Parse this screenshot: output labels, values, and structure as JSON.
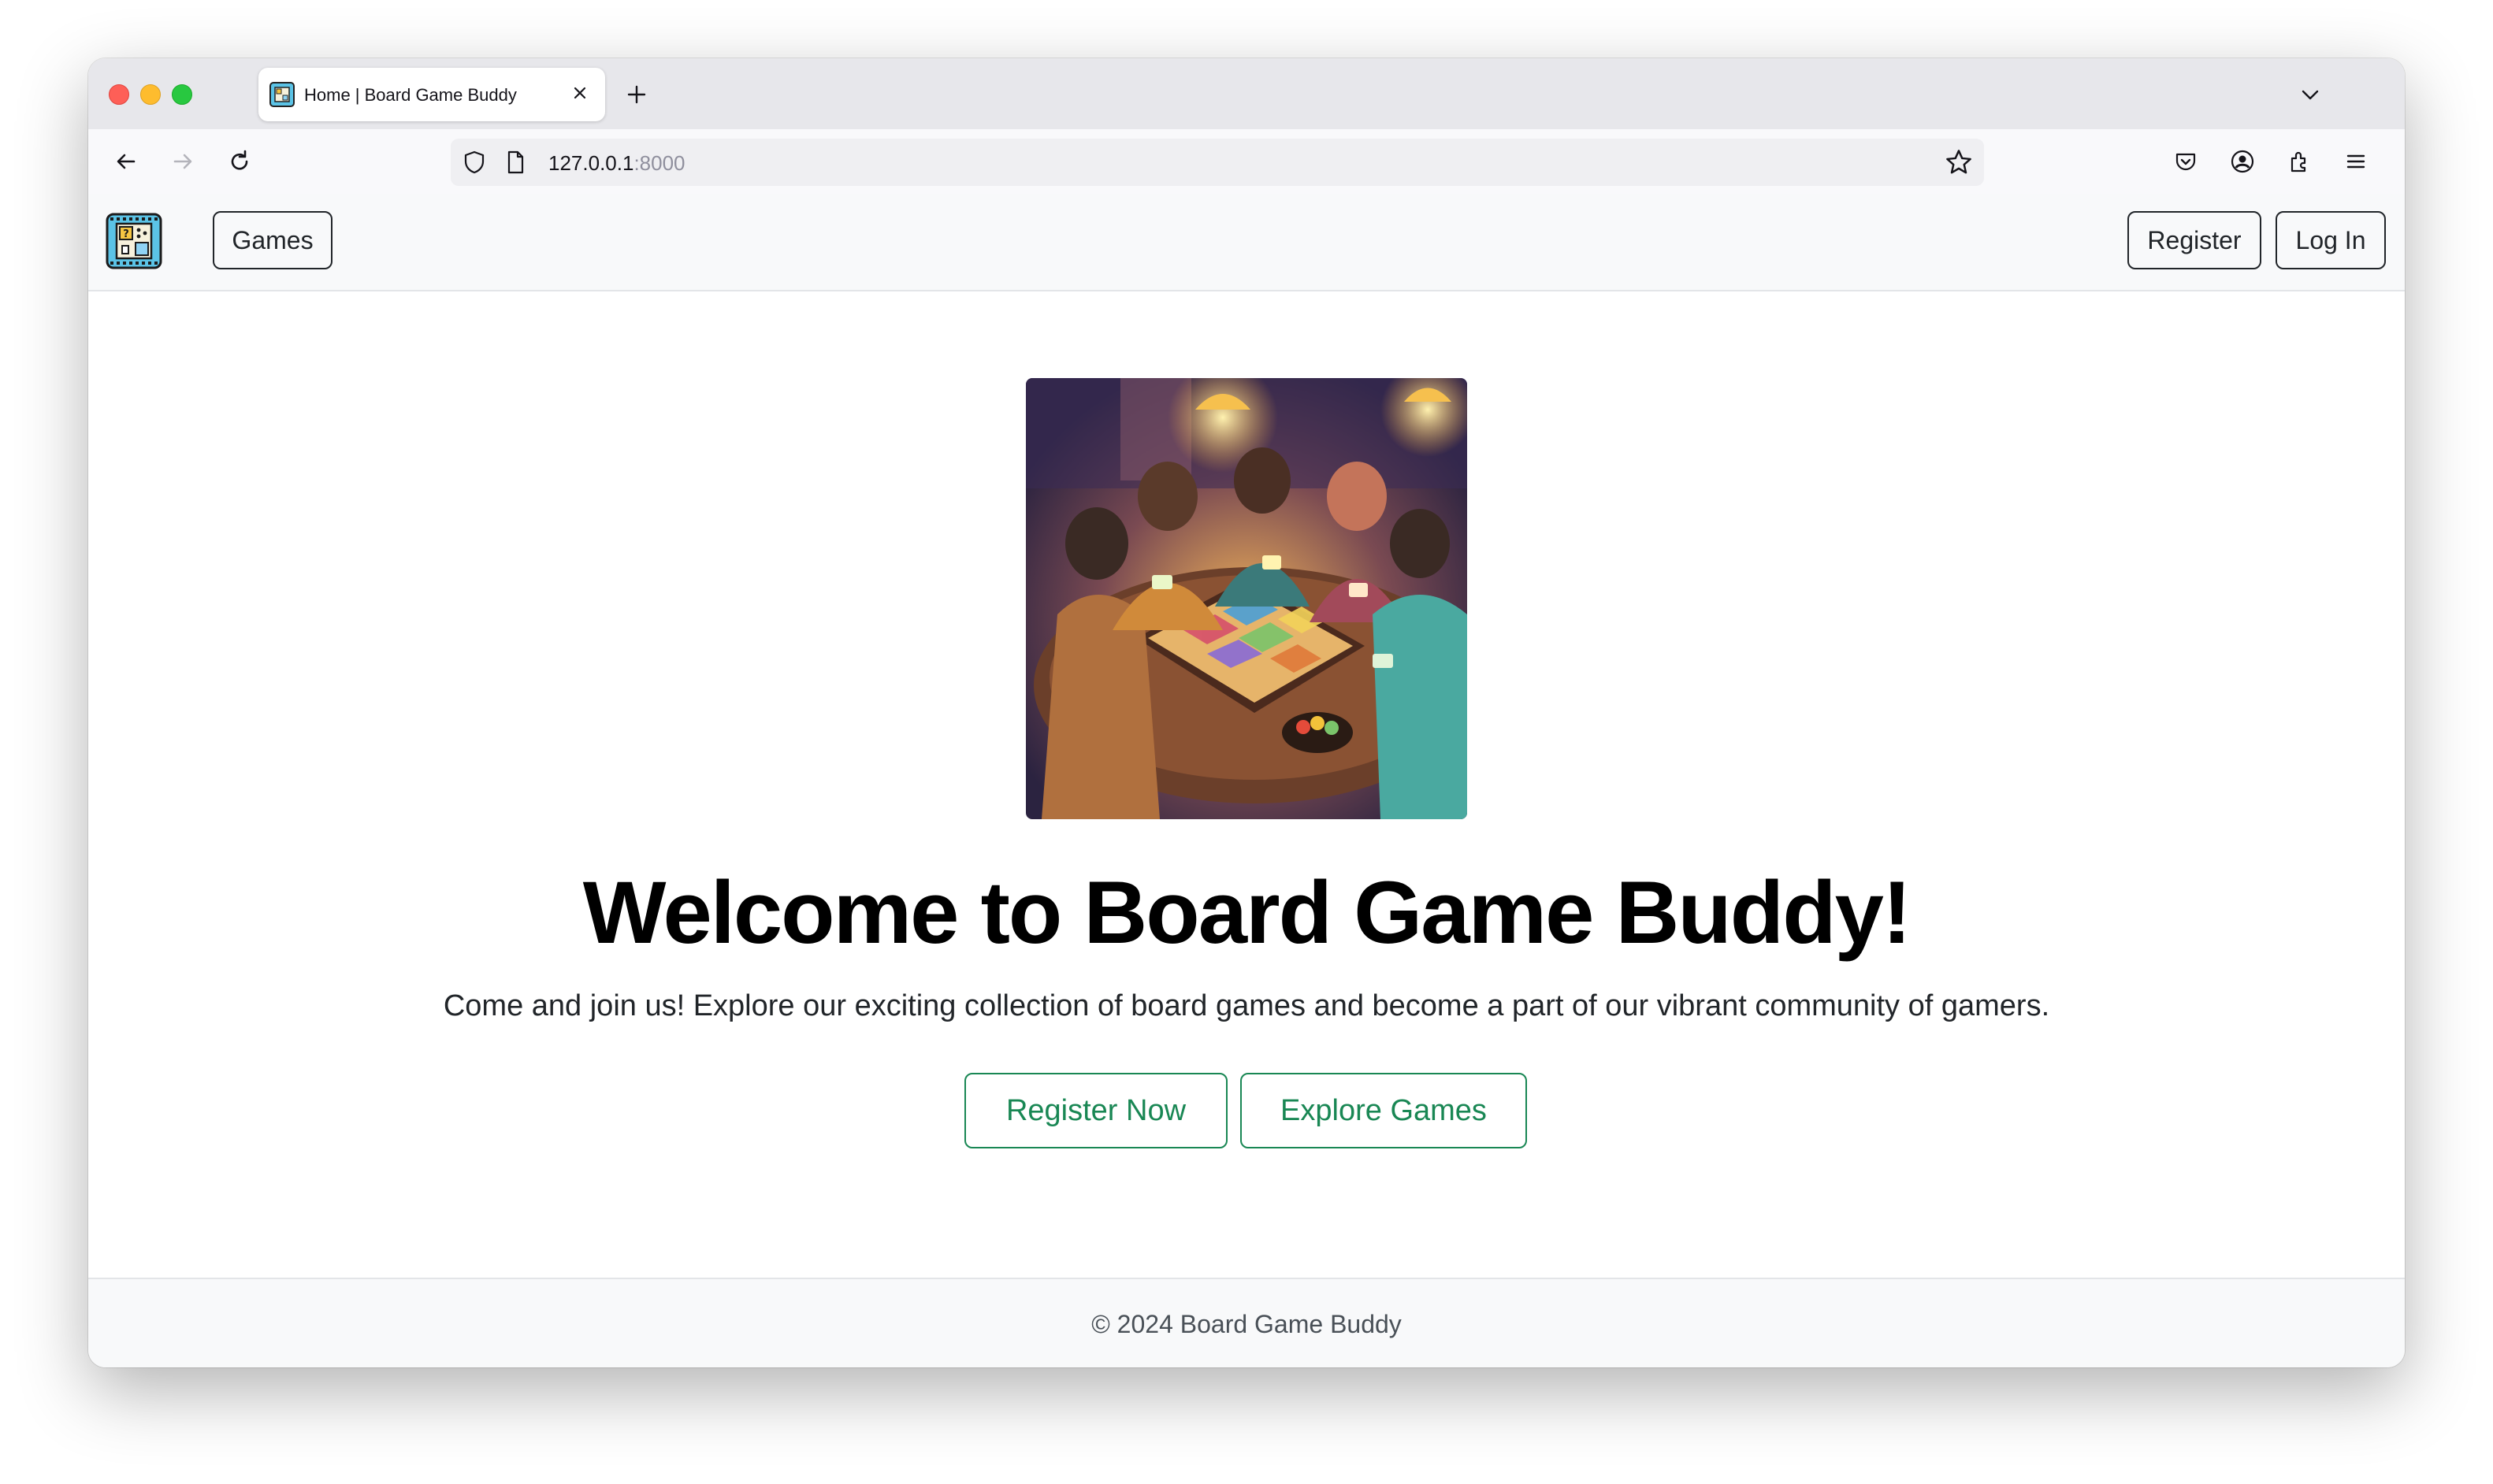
{
  "browser": {
    "tab_title": "Home | Board Game Buddy",
    "url_host": "127.0.0.1",
    "url_port": ":8000",
    "icons": [
      "back-arrow-icon",
      "forward-arrow-icon",
      "reload-icon",
      "shield-icon",
      "page-icon",
      "bookmark-star-icon",
      "pocket-icon",
      "account-icon",
      "extensions-icon",
      "menu-icon",
      "new-tab-plus-icon",
      "tab-list-chevron-icon",
      "close-icon"
    ]
  },
  "nav": {
    "games_label": "Games",
    "register_label": "Register",
    "login_label": "Log In"
  },
  "hero": {
    "title": "Welcome to Board Game Buddy!",
    "lead": "Come and join us! Explore our exciting collection of board games and become a part of our vibrant community of gamers.",
    "register_now_label": "Register Now",
    "explore_label": "Explore Games"
  },
  "footer": {
    "text": "© 2024 Board Game Buddy"
  },
  "colors": {
    "accent_success": "#198754",
    "dark": "#212529",
    "navbar_bg": "#f8f9fa"
  }
}
